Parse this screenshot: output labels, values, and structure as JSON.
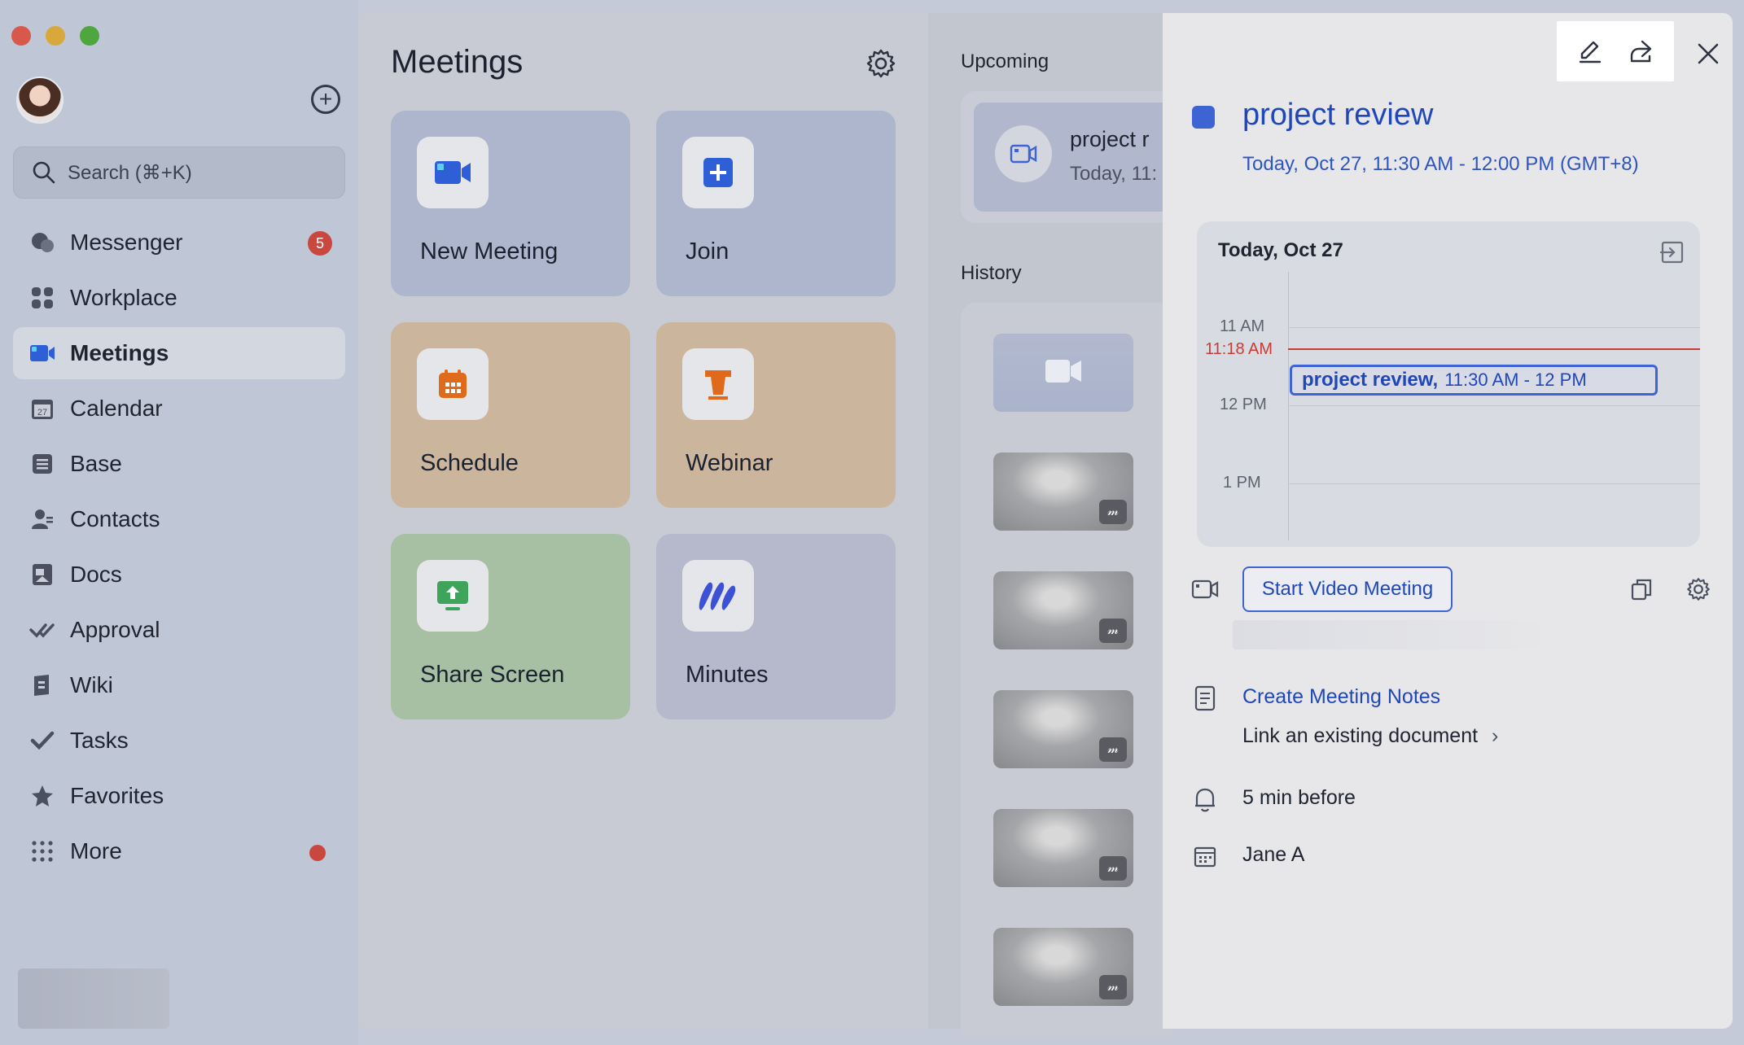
{
  "sidebar": {
    "search_placeholder": "Search (⌘+K)",
    "items": [
      {
        "label": "Messenger",
        "badge": "5"
      },
      {
        "label": "Workplace"
      },
      {
        "label": "Meetings"
      },
      {
        "label": "Calendar"
      },
      {
        "label": "Base"
      },
      {
        "label": "Contacts"
      },
      {
        "label": "Docs"
      },
      {
        "label": "Approval"
      },
      {
        "label": "Wiki"
      },
      {
        "label": "Tasks"
      },
      {
        "label": "Favorites"
      },
      {
        "label": "More"
      }
    ],
    "calendar_icon_number": "27"
  },
  "meetings": {
    "title": "Meetings",
    "tiles": [
      {
        "label": "New Meeting"
      },
      {
        "label": "Join"
      },
      {
        "label": "Schedule"
      },
      {
        "label": "Webinar"
      },
      {
        "label": "Share Screen"
      },
      {
        "label": "Minutes"
      }
    ]
  },
  "list_column": {
    "upcoming_title": "Upcoming",
    "upcoming_card": {
      "title": "project r",
      "time": "Today, 11:"
    },
    "history_title": "History"
  },
  "detail": {
    "title": "project review",
    "time": "Today, Oct 27, 11:30 AM - 12:00 PM (GMT+8)",
    "calendar": {
      "date": "Today, Oct 27",
      "hours": [
        "11 AM",
        "12 PM",
        "1 PM"
      ],
      "now_label": "11:18 AM",
      "event_title": "project review,",
      "event_time": "11:30 AM - 12 PM"
    },
    "start_video_label": "Start Video Meeting",
    "create_notes_label": "Create Meeting Notes",
    "link_document_label": "Link an existing document",
    "reminder": "5 min before",
    "organizer": "Jane A"
  },
  "colors": {
    "accent": "#3e63d3",
    "now_line": "#cc3b33",
    "badge": "#c9473f"
  }
}
